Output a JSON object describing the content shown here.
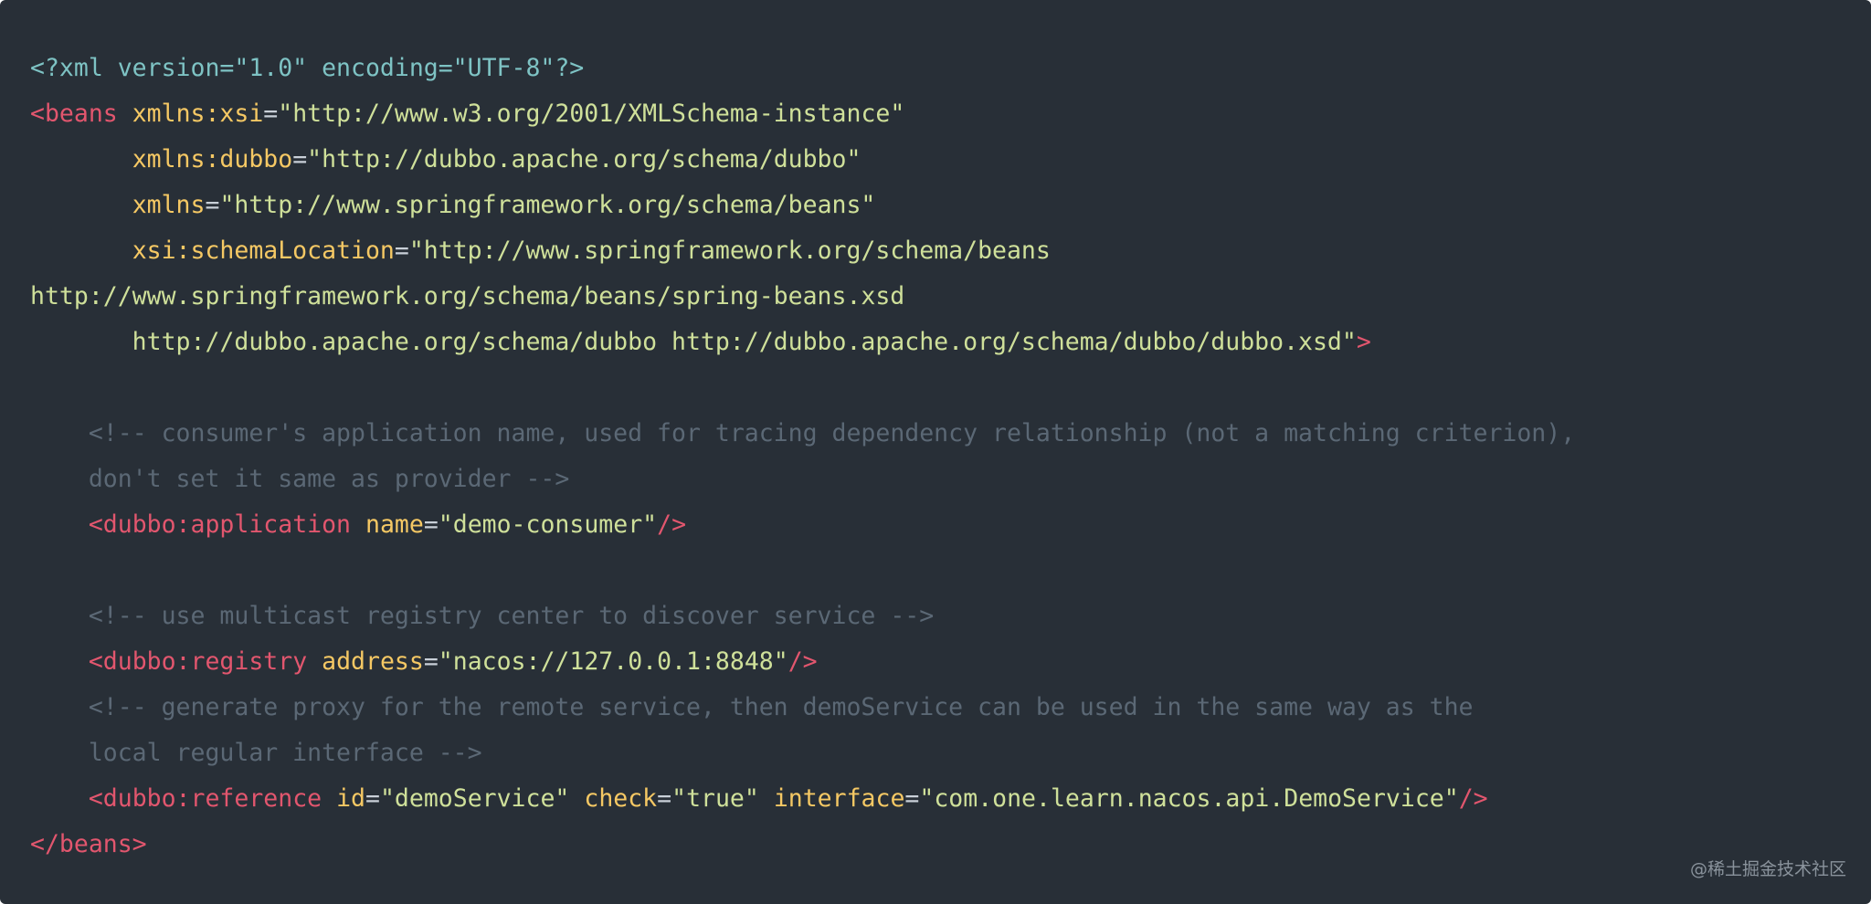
{
  "lines": [
    [
      {
        "t": "decl",
        "v": "<?xml version=\"1.0\" encoding=\"UTF-8\"?>"
      }
    ],
    [
      {
        "t": "tag",
        "v": "<beans"
      },
      {
        "t": "plain",
        "v": " "
      },
      {
        "t": "attr",
        "v": "xmlns:xsi"
      },
      {
        "t": "eq",
        "v": "="
      },
      {
        "t": "val",
        "v": "\"http://www.w3.org/2001/XMLSchema-instance\""
      }
    ],
    [
      {
        "t": "plain",
        "v": "       "
      },
      {
        "t": "attr",
        "v": "xmlns:dubbo"
      },
      {
        "t": "eq",
        "v": "="
      },
      {
        "t": "val",
        "v": "\"http://dubbo.apache.org/schema/dubbo\""
      }
    ],
    [
      {
        "t": "plain",
        "v": "       "
      },
      {
        "t": "attr",
        "v": "xmlns"
      },
      {
        "t": "eq",
        "v": "="
      },
      {
        "t": "val",
        "v": "\"http://www.springframework.org/schema/beans\""
      }
    ],
    [
      {
        "t": "plain",
        "v": "       "
      },
      {
        "t": "attr",
        "v": "xsi:schemaLocation"
      },
      {
        "t": "eq",
        "v": "="
      },
      {
        "t": "val",
        "v": "\"http://www.springframework.org/schema/beans"
      }
    ],
    [
      {
        "t": "val",
        "v": "http://www.springframework.org/schema/beans/spring-beans.xsd"
      }
    ],
    [
      {
        "t": "val",
        "v": "       http://dubbo.apache.org/schema/dubbo http://dubbo.apache.org/schema/dubbo/dubbo.xsd\""
      },
      {
        "t": "tag",
        "v": ">"
      }
    ],
    [],
    [
      {
        "t": "plain",
        "v": "    "
      },
      {
        "t": "comment",
        "v": "<!-- consumer's application name, used for tracing dependency relationship (not a matching criterion),"
      }
    ],
    [
      {
        "t": "comment",
        "v": "    don't set it same as provider -->"
      }
    ],
    [
      {
        "t": "plain",
        "v": "    "
      },
      {
        "t": "tag",
        "v": "<dubbo:application"
      },
      {
        "t": "plain",
        "v": " "
      },
      {
        "t": "attr",
        "v": "name"
      },
      {
        "t": "eq",
        "v": "="
      },
      {
        "t": "val",
        "v": "\"demo-consumer\""
      },
      {
        "t": "tag",
        "v": "/>"
      }
    ],
    [],
    [
      {
        "t": "plain",
        "v": "    "
      },
      {
        "t": "comment",
        "v": "<!-- use multicast registry center to discover service -->"
      }
    ],
    [
      {
        "t": "plain",
        "v": "    "
      },
      {
        "t": "tag",
        "v": "<dubbo:registry"
      },
      {
        "t": "plain",
        "v": " "
      },
      {
        "t": "attr",
        "v": "address"
      },
      {
        "t": "eq",
        "v": "="
      },
      {
        "t": "val",
        "v": "\"nacos://127.0.0.1:8848\""
      },
      {
        "t": "tag",
        "v": "/>"
      }
    ],
    [
      {
        "t": "plain",
        "v": "    "
      },
      {
        "t": "comment",
        "v": "<!-- generate proxy for the remote service, then demoService can be used in the same way as the"
      }
    ],
    [
      {
        "t": "comment",
        "v": "    local regular interface -->"
      }
    ],
    [
      {
        "t": "plain",
        "v": "    "
      },
      {
        "t": "tag",
        "v": "<dubbo:reference"
      },
      {
        "t": "plain",
        "v": " "
      },
      {
        "t": "attr",
        "v": "id"
      },
      {
        "t": "eq",
        "v": "="
      },
      {
        "t": "val",
        "v": "\"demoService\""
      },
      {
        "t": "plain",
        "v": " "
      },
      {
        "t": "attr",
        "v": "check"
      },
      {
        "t": "eq",
        "v": "="
      },
      {
        "t": "val",
        "v": "\"true\""
      },
      {
        "t": "plain",
        "v": " "
      },
      {
        "t": "attr",
        "v": "interface"
      },
      {
        "t": "eq",
        "v": "="
      },
      {
        "t": "val",
        "v": "\"com.one.learn.nacos.api.DemoService\""
      },
      {
        "t": "tag",
        "v": "/>"
      }
    ],
    [
      {
        "t": "tag",
        "v": "</beans>"
      }
    ]
  ],
  "watermark": "@稀土掘金技术社区",
  "colors": {
    "background": "#282f37",
    "declaration": "#7ec3c4",
    "tag": "#e2566e",
    "attribute": "#f5c864",
    "value": "#cfe09a",
    "comment": "#5b6875"
  }
}
